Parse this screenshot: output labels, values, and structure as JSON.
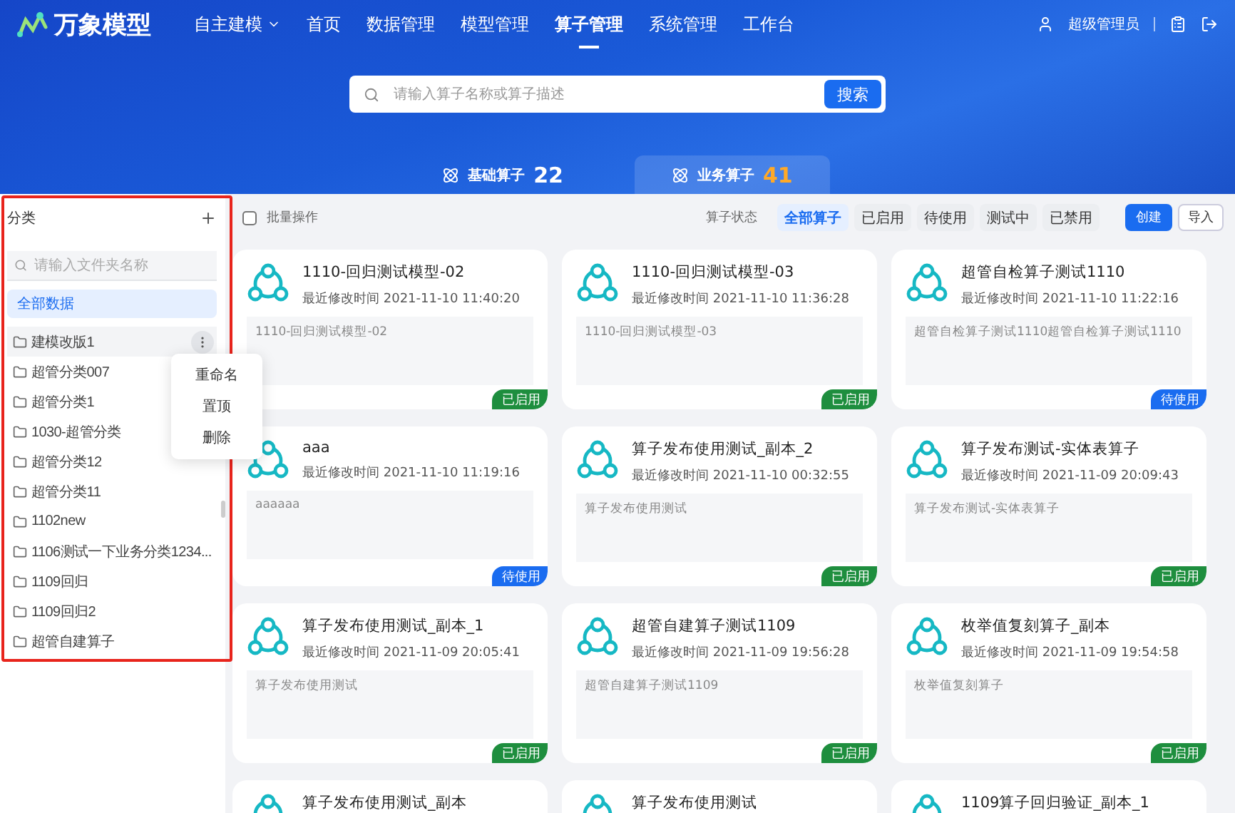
{
  "logo": {
    "text": "万象模型"
  },
  "nav": [
    {
      "label": "自主建模",
      "dropdown": true,
      "selected": false
    },
    {
      "label": "首页",
      "dropdown": false,
      "selected": false
    },
    {
      "label": "数据管理",
      "dropdown": false,
      "selected": false
    },
    {
      "label": "模型管理",
      "dropdown": false,
      "selected": false
    },
    {
      "label": "算子管理",
      "dropdown": false,
      "selected": true
    },
    {
      "label": "系统管理",
      "dropdown": false,
      "selected": false
    },
    {
      "label": "工作台",
      "dropdown": false,
      "selected": false
    }
  ],
  "user": {
    "name": "超级管理员"
  },
  "search": {
    "placeholder": "请输入算子名称或算子描述",
    "button": "搜索"
  },
  "stats": [
    {
      "label": "基础算子",
      "count": "22",
      "selected": false
    },
    {
      "label": "业务算子",
      "count": "41",
      "selected": true
    }
  ],
  "sidebar": {
    "title": "分类",
    "search_placeholder": "请输入文件夹名称",
    "all": {
      "label": "全部数据",
      "selected": true
    },
    "folders": [
      {
        "name": "建模改版1",
        "hovered": true
      },
      {
        "name": "超管分类007",
        "hovered": false
      },
      {
        "name": "超管分类1",
        "hovered": false
      },
      {
        "name": "1030-超管分类",
        "hovered": false
      },
      {
        "name": "超管分类12",
        "hovered": false
      },
      {
        "name": "超管分类11",
        "hovered": false
      },
      {
        "name": "1102new",
        "hovered": false
      },
      {
        "name": "1106测试一下业务分类1234...",
        "hovered": false
      },
      {
        "name": "1109回归",
        "hovered": false
      },
      {
        "name": "1109回归2",
        "hovered": false
      },
      {
        "name": "超管自建算子",
        "hovered": false
      }
    ],
    "context_menu": [
      "重命名",
      "置顶",
      "删除"
    ]
  },
  "toolbar": {
    "batch": {
      "label": "批量操作",
      "checked": false
    },
    "status_label": "算子状态",
    "filters": [
      {
        "label": "全部算子",
        "selected": true
      },
      {
        "label": "已启用",
        "selected": false
      },
      {
        "label": "待使用",
        "selected": false
      },
      {
        "label": "测试中",
        "selected": false
      },
      {
        "label": "已禁用",
        "selected": false
      }
    ],
    "create": "创建",
    "import": "导入"
  },
  "cards": [
    {
      "title": "1110-回归测试模型-02",
      "time": "最近修改时间 2021-11-10 11:40:20",
      "description": "1110-回归测试模型-02",
      "status": {
        "label": "已启用",
        "color": "#1e8e3e"
      }
    },
    {
      "title": "1110-回归测试模型-03",
      "time": "最近修改时间 2021-11-10 11:36:28",
      "description": "1110-回归测试模型-03",
      "status": {
        "label": "已启用",
        "color": "#1e8e3e"
      }
    },
    {
      "title": "超管自检算子测试1110",
      "time": "最近修改时间 2021-11-10 11:22:16",
      "description": "超管自检算子测试1110超管自检算子测试1110",
      "status": {
        "label": "待使用",
        "color": "#1a6cf0"
      }
    },
    {
      "title": "aaa",
      "time": "最近修改时间 2021-11-10 11:19:16",
      "description": "aaaaaa",
      "status": {
        "label": "待使用",
        "color": "#1a6cf0"
      }
    },
    {
      "title": "算子发布使用测试_副本_2",
      "time": "最近修改时间 2021-11-10 00:32:55",
      "description": "算子发布使用测试",
      "status": {
        "label": "已启用",
        "color": "#1e8e3e"
      }
    },
    {
      "title": "算子发布测试-实体表算子",
      "time": "最近修改时间 2021-11-09 20:09:43",
      "description": "算子发布测试-实体表算子",
      "status": {
        "label": "已启用",
        "color": "#1e8e3e"
      }
    },
    {
      "title": "算子发布使用测试_副本_1",
      "time": "最近修改时间 2021-11-09 20:05:41",
      "description": "算子发布使用测试",
      "status": {
        "label": "已启用",
        "color": "#1e8e3e"
      }
    },
    {
      "title": "超管自建算子测试1109",
      "time": "最近修改时间 2021-11-09 19:56:28",
      "description": "超管自建算子测试1109",
      "status": {
        "label": "已启用",
        "color": "#1e8e3e"
      }
    },
    {
      "title": "枚举值复刻算子_副本",
      "time": "最近修改时间 2021-11-09 19:54:58",
      "description": "枚举值复刻算子",
      "status": {
        "label": "已启用",
        "color": "#1e8e3e"
      }
    },
    {
      "title": "算子发布使用测试_副本"
    },
    {
      "title": "算子发布使用测试"
    },
    {
      "title": "1109算子回归验证_副本_1"
    }
  ]
}
